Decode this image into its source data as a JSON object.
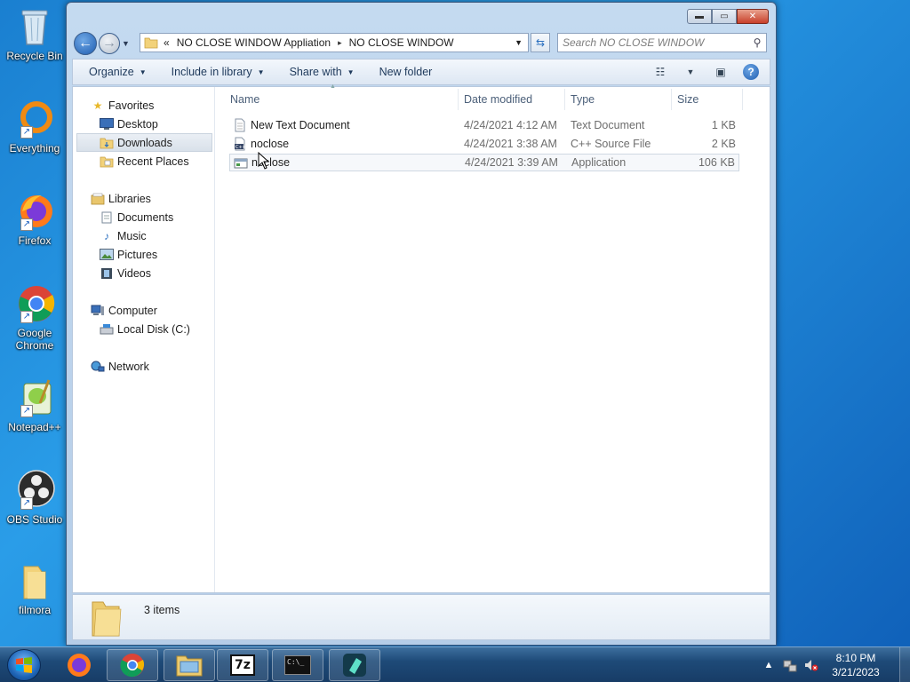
{
  "desktop": {
    "icons": [
      {
        "label": "Recycle Bin"
      },
      {
        "label": "Everything"
      },
      {
        "label": "Firefox"
      },
      {
        "label": "Google Chrome"
      },
      {
        "label": "Notepad++"
      },
      {
        "label": "OBS Studio"
      },
      {
        "label": "filmora"
      }
    ]
  },
  "window": {
    "caption": {
      "minimize": "▬",
      "maximize": "▭",
      "close": "✕"
    },
    "address": {
      "overflow": "«",
      "crumbs": [
        "NO CLOSE WINDOW Appliation",
        "NO CLOSE WINDOW"
      ],
      "separator": "▸"
    },
    "search_placeholder": "Search NO CLOSE WINDOW",
    "toolbar": {
      "organize": "Organize",
      "include_in_library": "Include in library",
      "share_with": "Share with",
      "new_folder": "New folder"
    },
    "navpane": {
      "favorites": "Favorites",
      "desktop": "Desktop",
      "downloads": "Downloads",
      "recent_places": "Recent Places",
      "libraries": "Libraries",
      "documents": "Documents",
      "music": "Music",
      "pictures": "Pictures",
      "videos": "Videos",
      "computer": "Computer",
      "local_disk": "Local Disk (C:)",
      "network": "Network"
    },
    "columns": {
      "name": "Name",
      "date_modified": "Date modified",
      "type": "Type",
      "size": "Size"
    },
    "files": [
      {
        "name": "New Text Document",
        "date": "4/24/2021 4:12 AM",
        "type": "Text Document",
        "size": "1 KB"
      },
      {
        "name": "noclose",
        "date": "4/24/2021 3:38 AM",
        "type": "C++ Source File",
        "size": "2 KB"
      },
      {
        "name": "noclose",
        "date": "4/24/2021 3:39 AM",
        "type": "Application",
        "size": "106 KB"
      }
    ],
    "details": {
      "item_count": "3 items"
    }
  },
  "taskbar": {
    "apps": [
      "firefox",
      "chrome",
      "windows-explorer",
      "7zip",
      "command-prompt",
      "filmora"
    ],
    "sevenzip_label": "7z",
    "cmd_label": "C:\\_",
    "clock": {
      "time": "8:10 PM",
      "date": "3/21/2023"
    }
  }
}
